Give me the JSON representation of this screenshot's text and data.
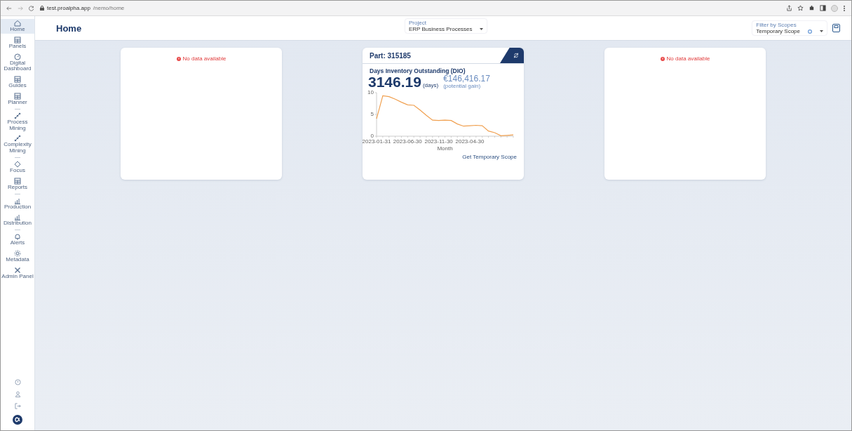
{
  "browser": {
    "url_host": "test.proalpha.app",
    "url_path": "/nemo/home"
  },
  "sidebar": {
    "items": [
      {
        "kind": "item",
        "label": "Home",
        "selected": true
      },
      {
        "kind": "item",
        "label": "Panels",
        "selected": false
      },
      {
        "kind": "item",
        "label": "Digital Dashboard",
        "selected": false
      },
      {
        "kind": "item",
        "label": "Guides",
        "selected": false
      },
      {
        "kind": "item",
        "label": "Planner",
        "selected": false
      },
      {
        "kind": "divider"
      },
      {
        "kind": "item",
        "label": "Process Mining",
        "selected": false
      },
      {
        "kind": "item",
        "label": "Complexity Mining",
        "selected": false
      },
      {
        "kind": "divider"
      },
      {
        "kind": "item",
        "label": "Focus",
        "selected": false
      },
      {
        "kind": "item",
        "label": "Reports",
        "selected": false
      },
      {
        "kind": "divider"
      },
      {
        "kind": "item",
        "label": "Production",
        "selected": false
      },
      {
        "kind": "item",
        "label": "Distribution",
        "selected": false
      },
      {
        "kind": "divider"
      },
      {
        "kind": "item",
        "label": "Alerts",
        "selected": false
      },
      {
        "kind": "item",
        "label": "Metadata",
        "selected": false
      },
      {
        "kind": "item",
        "label": "Admin Panel",
        "selected": false
      }
    ]
  },
  "header": {
    "title": "Home",
    "project": {
      "label": "Project",
      "value": "ERP Business Processes"
    },
    "scope_filter": {
      "label": "Filter by Scopes",
      "value": "Temporary Scope"
    }
  },
  "cards": [
    {
      "kind": "empty",
      "message": "No data available"
    },
    {
      "kind": "kpi",
      "part": "Part: 315185",
      "metric": "Days Inventory Outstanding (DIO)",
      "value": "3146.19",
      "unit": "(days)",
      "gain": "€146,416.17",
      "gain_label": "(potential gain)",
      "action": "Get Temporary Scope",
      "chart_data": {
        "type": "line",
        "xlabel": "Month",
        "categories": [
          "2023-01-31",
          null,
          null,
          null,
          null,
          "2023-06-30",
          null,
          null,
          null,
          null,
          "2023-11-30",
          null,
          null,
          null,
          null,
          "2023-04-30",
          null,
          null,
          null,
          null,
          null,
          null,
          null
        ],
        "series": [
          {
            "color": "#f0a050",
            "values": [
              4,
              9.3,
              9.1,
              8.5,
              7.8,
              7.2,
              7.1,
              6.0,
              4.8,
              3.7,
              3.6,
              3.7,
              3.6,
              2.8,
              2.3,
              2.4,
              2.5,
              2.4,
              1.2,
              0.8,
              0.1,
              0.2,
              0.3
            ]
          }
        ],
        "ylim": [
          0,
          10
        ],
        "yticks": [
          0,
          5,
          10
        ]
      }
    },
    {
      "kind": "empty",
      "message": "No data available"
    }
  ]
}
